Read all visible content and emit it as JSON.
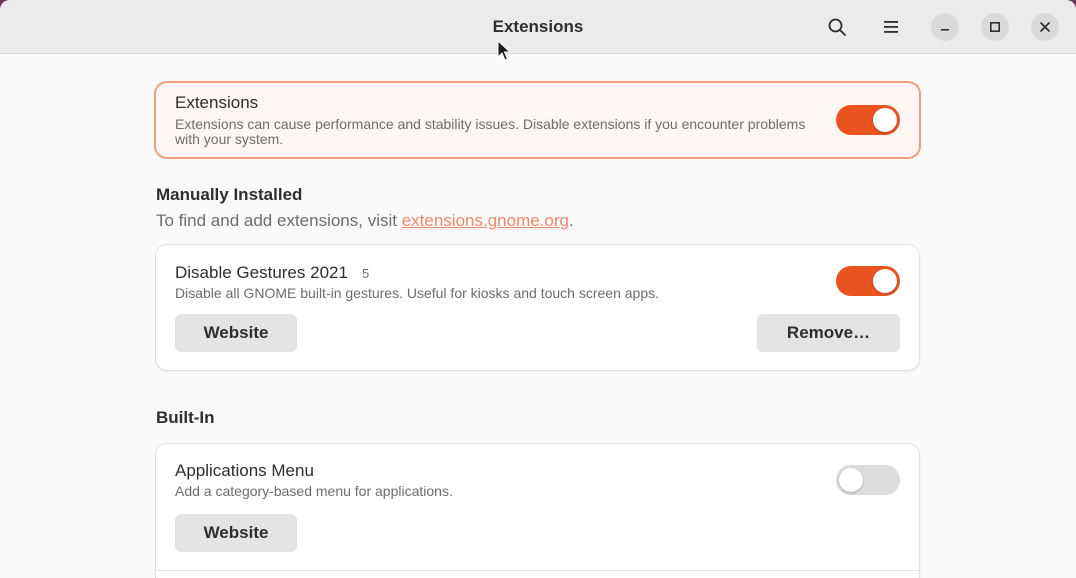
{
  "window": {
    "title": "Extensions"
  },
  "header": {
    "search_icon": "search-icon",
    "menu_icon": "hamburger-menu-icon",
    "minimize_icon": "minimize-icon",
    "maximize_icon": "maximize-icon",
    "close_icon": "close-icon"
  },
  "colors": {
    "accent": "#e95420",
    "warning_border": "#ee9f80",
    "link": "#e98a6b"
  },
  "global_toggle": {
    "title": "Extensions",
    "description": "Extensions can cause performance and stability issues. Disable extensions if you encounter problems with your system.",
    "enabled": true
  },
  "manually_installed": {
    "heading": "Manually Installed",
    "hint_prefix": "To find and add extensions, visit ",
    "hint_link": "extensions.gnome.org",
    "hint_suffix": ".",
    "extensions": [
      {
        "name": "Disable Gestures 2021",
        "version": "5",
        "description": "Disable all GNOME built-in gestures. Useful for kiosks and touch screen apps.",
        "enabled": true,
        "website_label": "Website",
        "remove_label": "Remove…"
      }
    ]
  },
  "built_in": {
    "heading": "Built-In",
    "extensions": [
      {
        "name": "Applications Menu",
        "description": "Add a category-based menu for applications.",
        "enabled": false,
        "website_label": "Website"
      }
    ]
  }
}
